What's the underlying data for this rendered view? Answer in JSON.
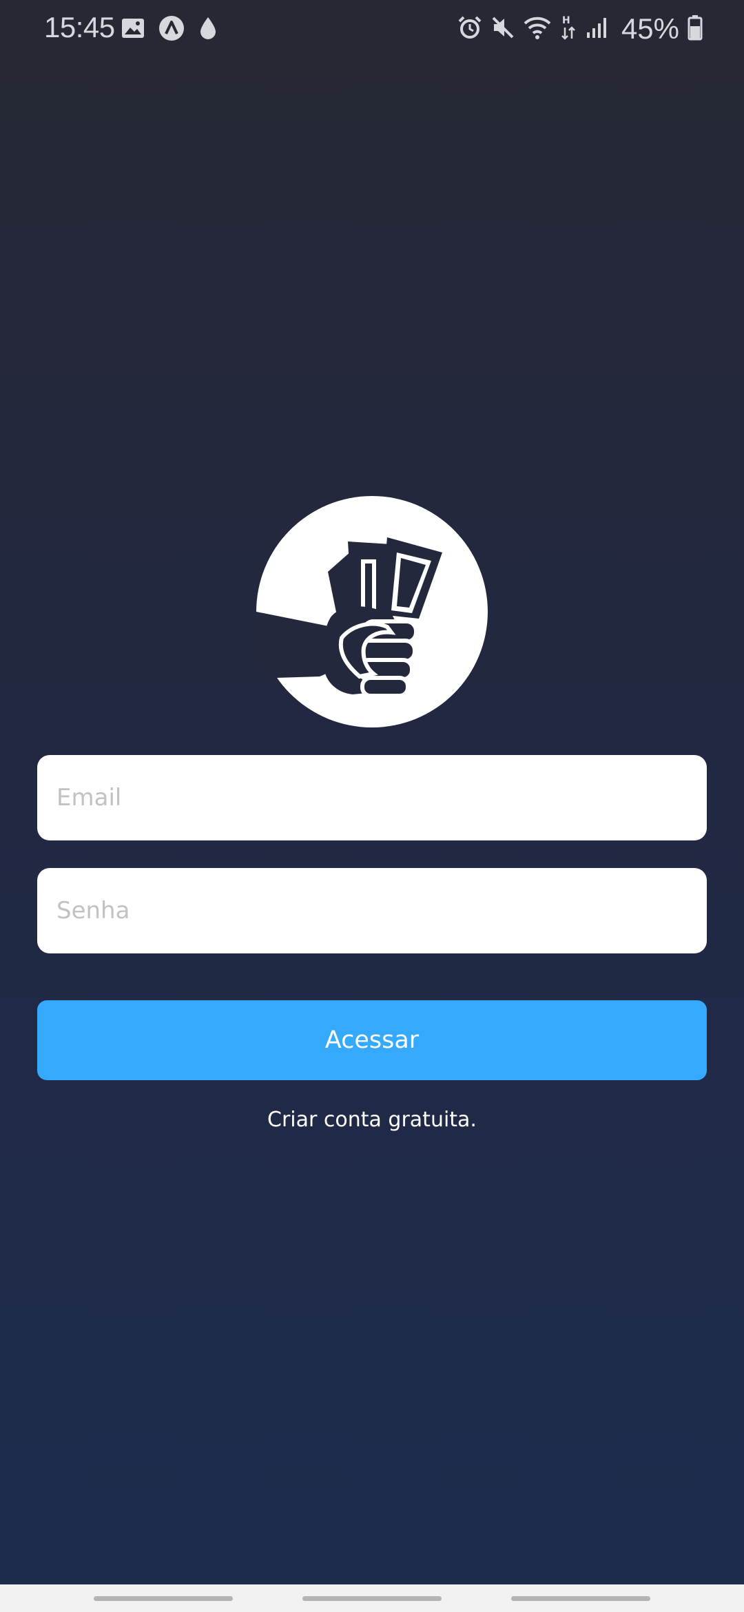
{
  "status_bar": {
    "time": "15:45",
    "battery_percent": "45%",
    "left_icons": [
      "image-icon",
      "app-a-icon",
      "drop-icon"
    ],
    "right_icons": [
      "alarm-icon",
      "mute-icon",
      "wifi-icon",
      "network-h-icon",
      "signal-icon",
      "battery-icon"
    ]
  },
  "login": {
    "email_placeholder": "Email",
    "password_placeholder": "Senha",
    "submit_label": "Acessar",
    "create_account_label": "Criar conta gratuita."
  },
  "colors": {
    "background_top": "#262833",
    "background_bottom": "#1d2b4d",
    "accent": "#35a9fb",
    "field_bg": "#ffffff"
  },
  "logo": {
    "icon": "fist-with-money-icon"
  }
}
